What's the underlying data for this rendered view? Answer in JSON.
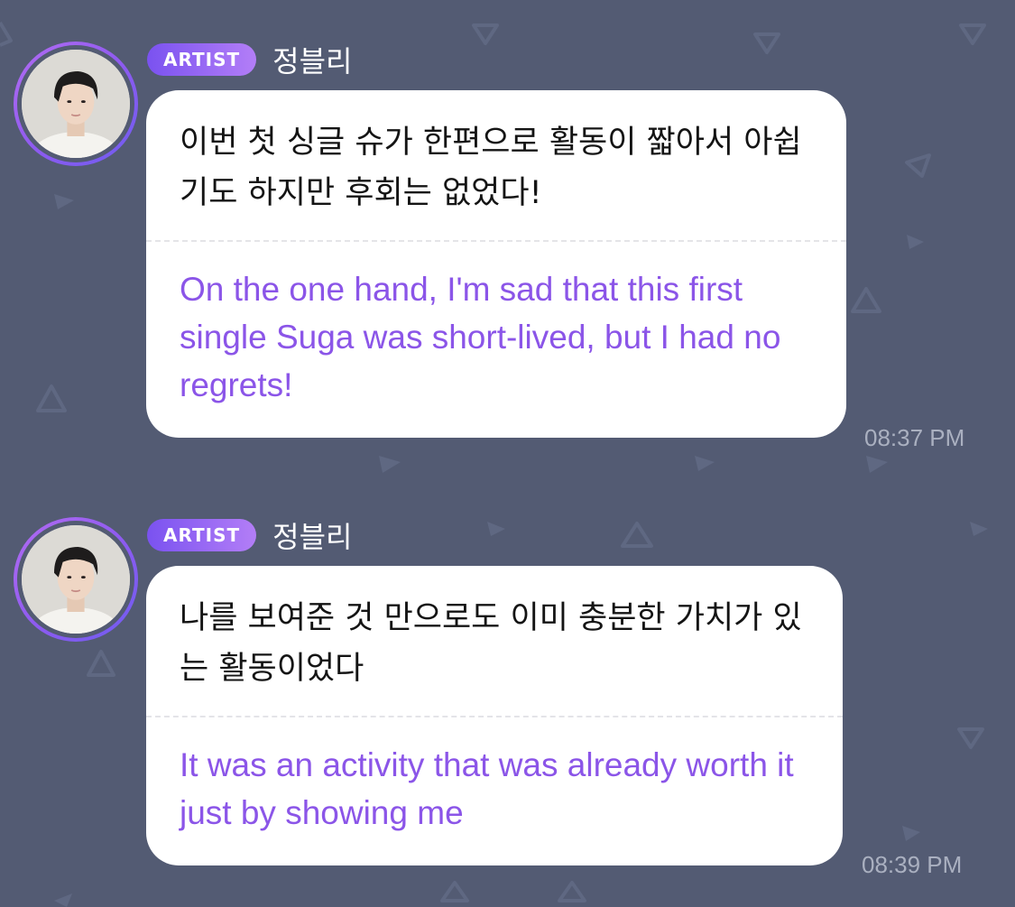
{
  "colors": {
    "background": "#535b73",
    "bubble": "#ffffff",
    "original_text": "#141414",
    "translation_text": "#8b55e8",
    "badge_start": "#7a52f0",
    "badge_end": "#b37ef7",
    "timestamp": "#aab0c0"
  },
  "messages": [
    {
      "badge": "ARTIST",
      "sender": "정블리",
      "avatar_icon": "profile-photo",
      "original": "이번 첫 싱글 슈가 한편으로 활동이 짧아서 아쉽기도 하지만 후회는 없었다!",
      "translation": "On the one hand, I'm sad that this first single Suga was short-lived, but I had no regrets!",
      "time": "08:37 PM"
    },
    {
      "badge": "ARTIST",
      "sender": "정블리",
      "avatar_icon": "profile-photo",
      "original": "나를 보여준 것 만으로도 이미 충분한 가치가 있는 활동이었다",
      "translation": "It was an activity that was already worth it just by showing me",
      "time": "08:39 PM"
    }
  ]
}
